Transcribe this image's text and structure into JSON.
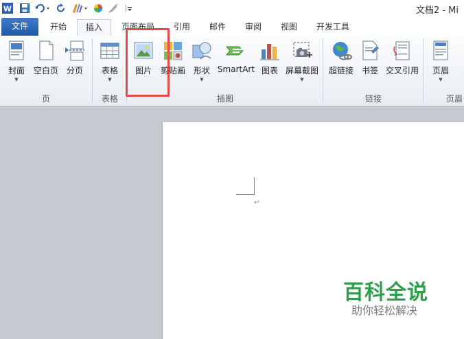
{
  "window": {
    "title": "文档2 - Mi"
  },
  "tabs": [
    {
      "label": "文件"
    },
    {
      "label": "开始"
    },
    {
      "label": "插入"
    },
    {
      "label": "页面布局"
    },
    {
      "label": "引用"
    },
    {
      "label": "邮件"
    },
    {
      "label": "审阅"
    },
    {
      "label": "视图"
    },
    {
      "label": "开发工具"
    }
  ],
  "ribbon": {
    "groups": {
      "pages": "页",
      "tables": "表格",
      "illustrations": "插图",
      "links": "链接",
      "header_footer": "页眉"
    },
    "buttons": {
      "cover": "封面",
      "blank_page": "空白页",
      "page_break": "分页",
      "table": "表格",
      "picture": "图片",
      "clipart": "剪贴画",
      "shapes": "形状",
      "smartart": "SmartArt",
      "chart": "图表",
      "screenshot": "屏幕截图",
      "hyperlink": "超链接",
      "bookmark": "书签",
      "cross_ref": "交叉引用",
      "header": "页眉"
    }
  },
  "document": {
    "paragraph_mark": "↵"
  },
  "watermark": {
    "title": "百科全说",
    "subtitle": "助你轻松解决"
  },
  "colors": {
    "accent": "#2b5fae",
    "highlight": "#e04a4a",
    "watermark": "#2e9f49"
  }
}
